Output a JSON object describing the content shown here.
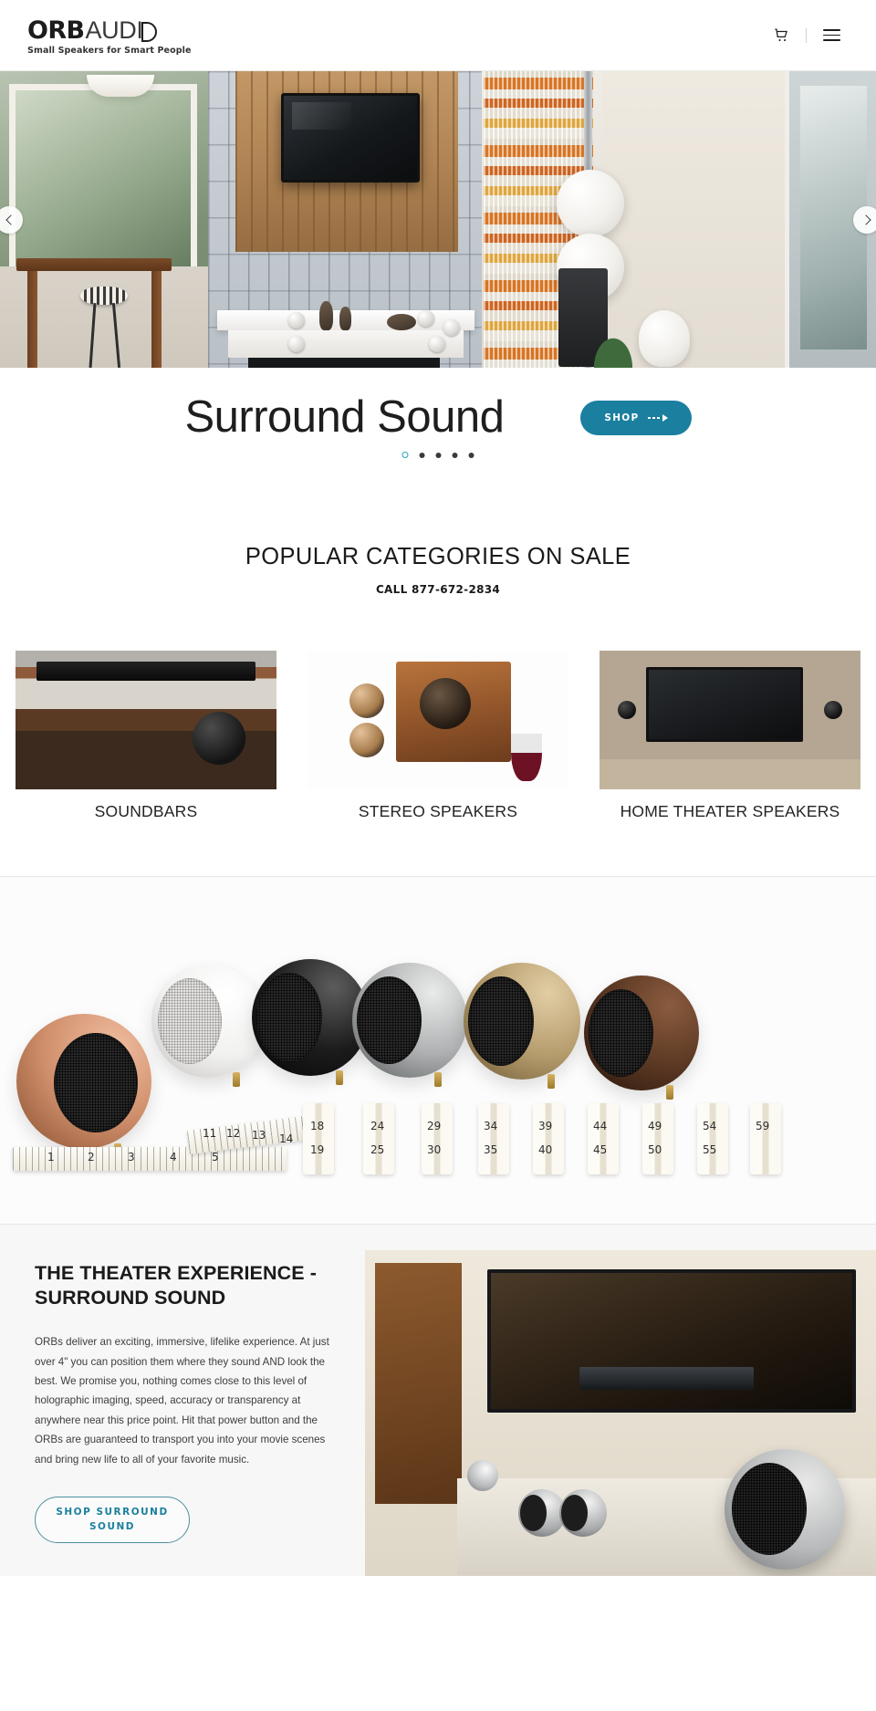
{
  "header": {
    "logo_orb": "ORB",
    "logo_audio": "AUDI",
    "tagline": "Small Speakers for Smart People",
    "cart_icon": "shopping-cart-icon",
    "menu_icon": "hamburger-menu-icon"
  },
  "hero": {
    "title": "Surround Sound",
    "shop_label": "SHOP",
    "prev_label": "Previous slide",
    "next_label": "Next slide",
    "slide_count": 5,
    "active_slide": 1
  },
  "categories": {
    "title": "POPULAR CATEGORIES ON SALE",
    "subtitle": "CALL 877-672-2834",
    "phone": "877-672-2834",
    "items": [
      {
        "label": "SOUNDBARS"
      },
      {
        "label": "STEREO SPEAKERS"
      },
      {
        "label": "HOME THEATER SPEAKERS"
      }
    ]
  },
  "lineup": {
    "alt": "Six Orb speakers in copper, white, black, steel, bronze and brown finishes beside a tape measure",
    "finishes": [
      "copper",
      "white",
      "black",
      "steel",
      "bronze",
      "brown"
    ],
    "tape_numbers": [
      "1",
      "2",
      "3",
      "4",
      "5",
      "11",
      "12",
      "13",
      "14",
      "18",
      "19",
      "24",
      "25",
      "29",
      "30",
      "34",
      "35",
      "39",
      "40",
      "44",
      "45",
      "49",
      "50",
      "54",
      "55",
      "59"
    ]
  },
  "theater": {
    "heading": "THE THEATER EXPERIENCE - SURROUND SOUND",
    "body": "ORBs deliver an exciting, immersive, lifelike experience. At just over 4\" you can position them where they sound AND look the best. We promise you, nothing comes close to this level of holographic imaging, speed, accuracy or transparency at anywhere near this price point. Hit that power button and the ORBs are guaranteed to transport you into your movie scenes and bring new life to all of your favorite music.",
    "cta": "SHOP SURROUND SOUND"
  },
  "colors": {
    "accent_teal": "#1b7fa0",
    "dot_active": "#25a5b8",
    "text_dark": "#1a1a1a",
    "section_bg": "#f7f7f7"
  }
}
